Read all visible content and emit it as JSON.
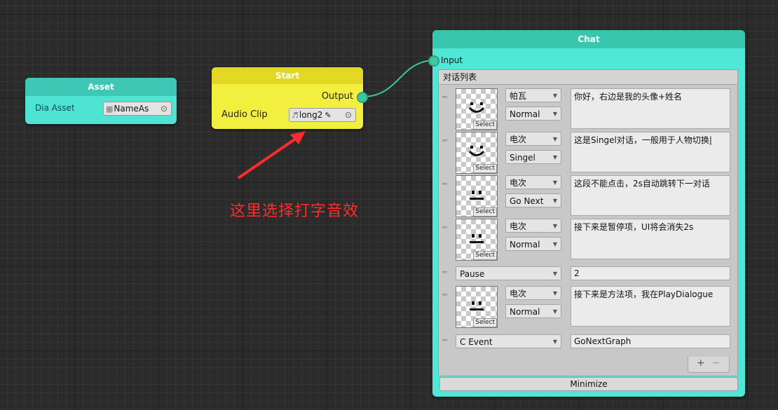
{
  "asset_node": {
    "title": "Asset",
    "field_label": "Dia Asset",
    "field_value": "NameAs",
    "field_icon": "asset-file-icon"
  },
  "start_node": {
    "title": "Start",
    "output_label": "Output",
    "audio_label": "Audio Clip",
    "audio_value": "long2",
    "audio_icon": "audio-clip-icon"
  },
  "annotation": {
    "text": "这里选择打字音效",
    "color": "#ff2c2c"
  },
  "chat_node": {
    "title": "Chat",
    "input_label": "Input",
    "list_title": "对话列表",
    "avatar_select_label": "Select",
    "rows": [
      {
        "type": "dialogue",
        "avatar": "smile-face-icon",
        "speaker": "帕瓦",
        "mode": "Normal",
        "text": "你好，右边是我的头像+姓名"
      },
      {
        "type": "dialogue",
        "avatar": "smile-face-icon",
        "speaker": "电次",
        "mode": "Singel",
        "text": "这是Singel对话，一般用于人物切换|"
      },
      {
        "type": "dialogue",
        "avatar": "neutral-face-icon",
        "speaker": "电次",
        "mode": "Go Next",
        "text": "这段不能点击，2s自动跳转下一对话"
      },
      {
        "type": "dialogue",
        "avatar": "neutral-face-icon",
        "speaker": "电次",
        "mode": "Normal",
        "text": "接下来是暂停项，UI将会消失2s"
      },
      {
        "type": "simple",
        "kind": "Pause",
        "value": "2"
      },
      {
        "type": "dialogue",
        "avatar": "neutral-face-icon",
        "speaker": "电次",
        "mode": "Normal",
        "text": "接下来是方法项，我在PlayDialogue"
      },
      {
        "type": "simple",
        "kind": "C Event",
        "value": "GoNextGraph"
      }
    ],
    "add_symbol": "+",
    "remove_symbol": "−",
    "minimize_label": "Minimize"
  },
  "colors": {
    "asset_body": "#4fe3d2",
    "start_body": "#f2ef3f",
    "chat_body": "#4fe8d6",
    "port": "#3ec7a0",
    "canvas": "#2b2b2b"
  }
}
